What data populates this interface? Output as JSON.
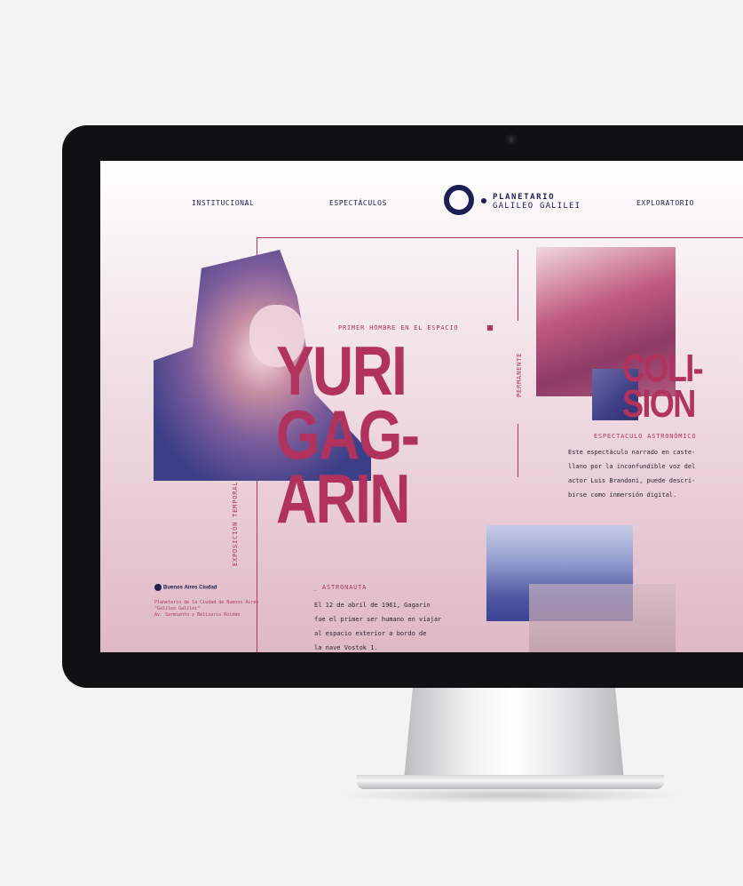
{
  "nav": {
    "items": [
      "INSTITUCIONAL",
      "ESPECTÁCULOS",
      "EXPLORATORIO"
    ],
    "logo_line1": "PLANETARIO",
    "logo_line2": "GALILEO GALILEI"
  },
  "feature": {
    "kicker": "PRIMER HOMBRE EN EL ESPACIO",
    "title_lines": [
      "YURI",
      "GAG-",
      "ARIN"
    ],
    "side_label": "EXPOSICIÓN TEMPORAL",
    "role": "_ ASTRONAUTA",
    "body_lines": [
      "El 12 de abril de 1961, Gagarin",
      "fue el primer ser humano en viajar",
      "al espacio exterior a bordo de",
      "la nave Vostok 1."
    ]
  },
  "show": {
    "side_label": "PERMANENTE",
    "title_lines": [
      "COLI-",
      "SION"
    ],
    "subtitle": "ESPECTACULO ASTRONÓMICO",
    "body_lines": [
      "Este espectáculo narrado en caste-",
      "llano por la inconfundible voz del",
      "actor Luis Brandoni, puede descri-",
      "birse como inmersión digital."
    ]
  },
  "footer": {
    "brand": "Buenos Aires Ciudad",
    "address_lines": [
      "Planetario de la Ciudad de Buenos Aires",
      "\"Galileo Galilei\"",
      "Av. Sarmiento y Belisario Roldán"
    ]
  },
  "colors": {
    "accent": "#b2325e",
    "navy": "#1c1f55"
  }
}
